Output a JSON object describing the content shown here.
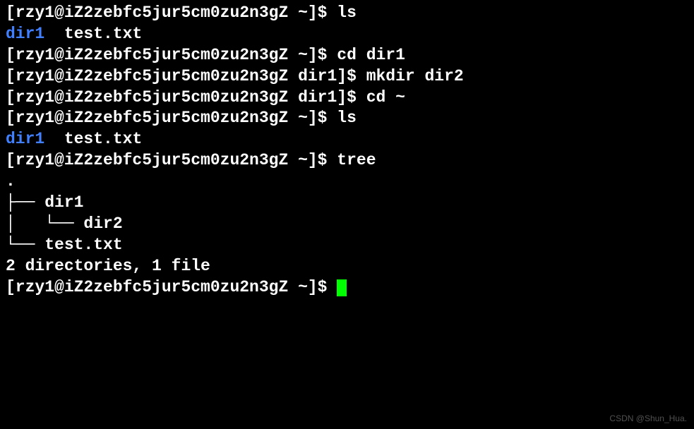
{
  "lines": {
    "l0_prompt": "[rzy1@iZ2zebfc5jur5cm0zu2n3gZ ~]$ ",
    "l0_cmd": "ls",
    "l1_dir": "dir1",
    "l1_rest": "  test.txt",
    "l2_prompt": "[rzy1@iZ2zebfc5jur5cm0zu2n3gZ ~]$ ",
    "l2_cmd": "cd dir1",
    "l3_prompt": "[rzy1@iZ2zebfc5jur5cm0zu2n3gZ dir1]$ ",
    "l3_cmd": "mkdir dir2",
    "l4_prompt": "[rzy1@iZ2zebfc5jur5cm0zu2n3gZ dir1]$ ",
    "l4_cmd": "cd ~",
    "l5_prompt": "[rzy1@iZ2zebfc5jur5cm0zu2n3gZ ~]$ ",
    "l5_cmd": "ls",
    "l6_dir": "dir1",
    "l6_rest": "  test.txt",
    "l7_prompt": "[rzy1@iZ2zebfc5jur5cm0zu2n3gZ ~]$ ",
    "l7_cmd": "tree",
    "l8": ".",
    "l9": "├── dir1",
    "l10": "│   └── dir2",
    "l11": "└── test.txt",
    "l12": "",
    "l13": "2 directories, 1 file",
    "l14_prompt": "[rzy1@iZ2zebfc5jur5cm0zu2n3gZ ~]$ "
  },
  "watermark": "CSDN @Shun_Hua."
}
